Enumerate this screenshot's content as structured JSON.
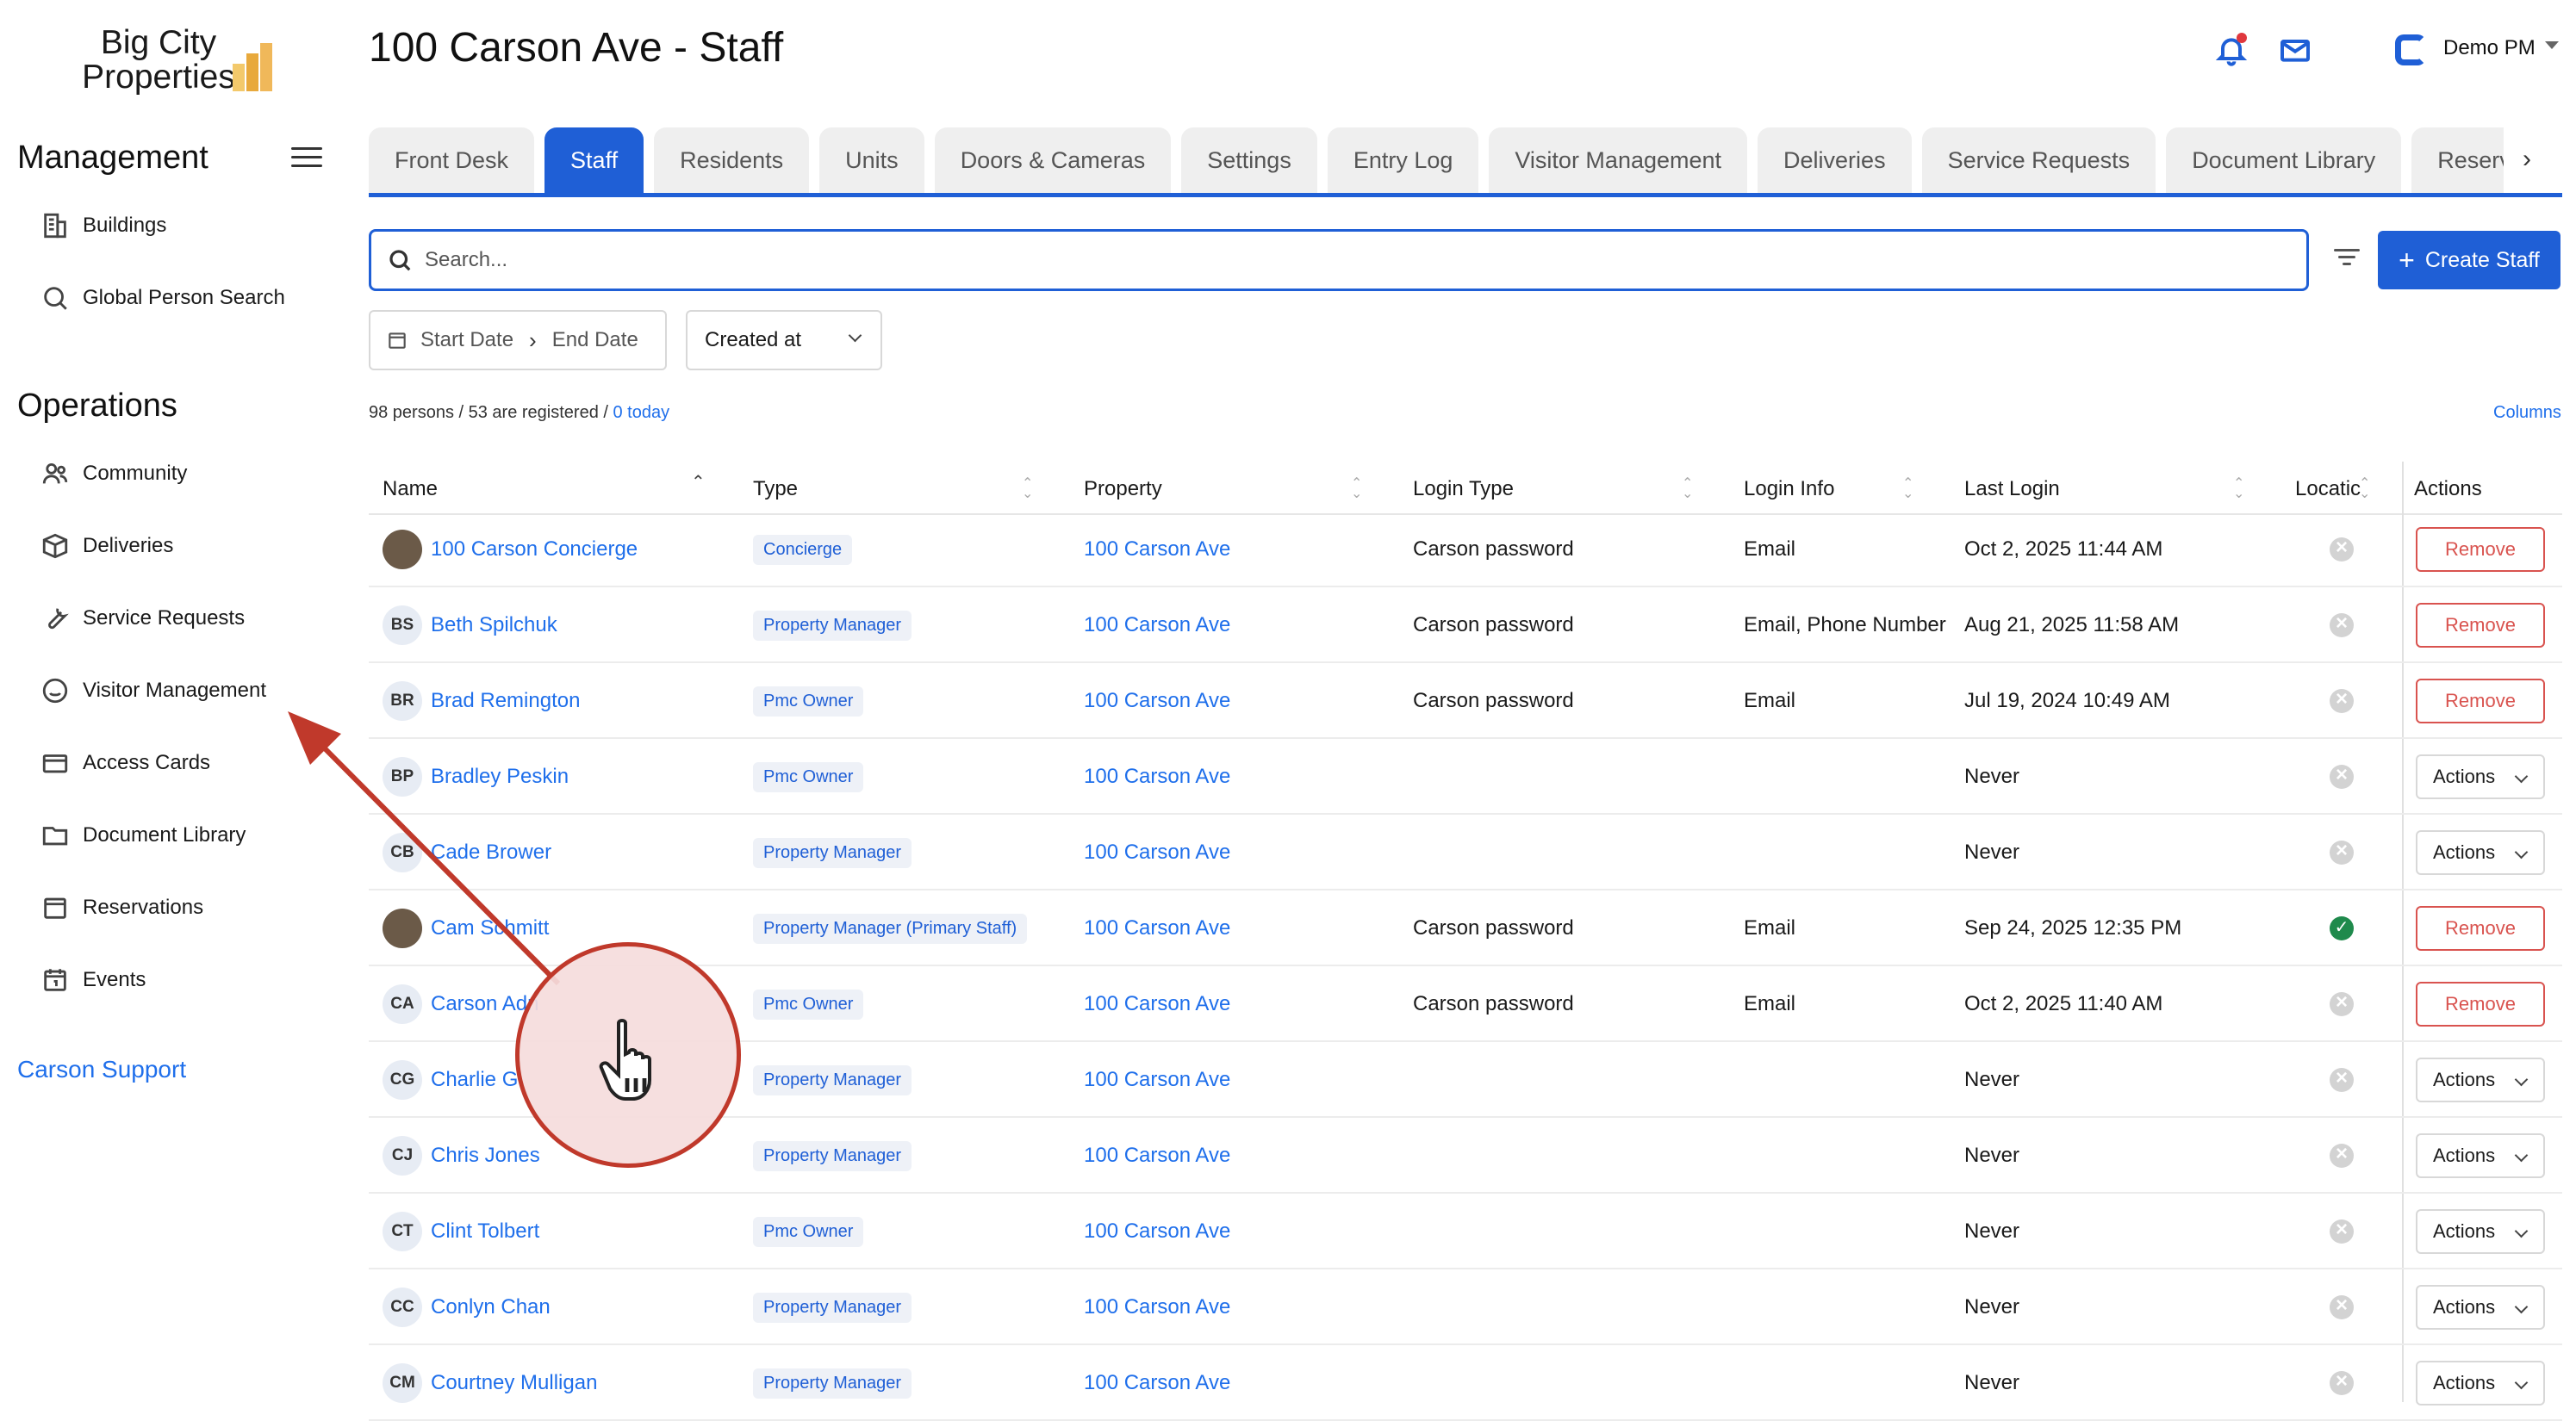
{
  "logo": {
    "line1": "Big City",
    "line2": "Properties"
  },
  "page_title": "100 Carson Ave - Staff",
  "user": {
    "name": "Demo PM"
  },
  "sidebar": {
    "management_title": "Management",
    "management_items": [
      {
        "label": "Buildings",
        "icon": "building-icon"
      },
      {
        "label": "Global Person Search",
        "icon": "search-icon"
      }
    ],
    "operations_title": "Operations",
    "operations_items": [
      {
        "label": "Community",
        "icon": "people-icon"
      },
      {
        "label": "Deliveries",
        "icon": "package-icon"
      },
      {
        "label": "Service Requests",
        "icon": "wrench-icon"
      },
      {
        "label": "Visitor Management",
        "icon": "smiley-icon"
      },
      {
        "label": "Access Cards",
        "icon": "card-icon"
      },
      {
        "label": "Document Library",
        "icon": "folder-icon"
      },
      {
        "label": "Reservations",
        "icon": "calendar-icon"
      },
      {
        "label": "Events",
        "icon": "calendar-event-icon"
      }
    ],
    "support_label": "Carson Support"
  },
  "tabs": [
    "Front Desk",
    "Staff",
    "Residents",
    "Units",
    "Doors & Cameras",
    "Settings",
    "Entry Log",
    "Visitor Management",
    "Deliveries",
    "Service Requests",
    "Document Library",
    "Reservab"
  ],
  "active_tab": "Staff",
  "search": {
    "placeholder": "Search..."
  },
  "create_button": "Create Staff",
  "date_filter": {
    "start": "Start Date",
    "end": "End Date"
  },
  "sort_select": "Created at",
  "stats": {
    "text": "98 persons / 53 are registered / ",
    "today": "0 today"
  },
  "columns_link": "Columns",
  "table": {
    "headers": [
      "Name",
      "Type",
      "Property",
      "Login Type",
      "Login Info",
      "Last Login",
      "Locatic",
      "Actions"
    ],
    "rows": [
      {
        "initials": "",
        "photo": true,
        "name": "100 Carson Concierge",
        "type": "Concierge",
        "property": "100 Carson Ave",
        "login_type": "Carson password",
        "login_info": "Email",
        "last_login": "Oct 2, 2025 11:44 AM",
        "location": "off",
        "action": "Remove"
      },
      {
        "initials": "BS",
        "photo": false,
        "name": "Beth Spilchuk",
        "type": "Property Manager",
        "property": "100 Carson Ave",
        "login_type": "Carson password",
        "login_info": "Email, Phone Number",
        "last_login": "Aug 21, 2025 11:58 AM",
        "location": "off",
        "action": "Remove"
      },
      {
        "initials": "BR",
        "photo": false,
        "name": "Brad Remington",
        "type": "Pmc Owner",
        "property": "100 Carson Ave",
        "login_type": "Carson password",
        "login_info": "Email",
        "last_login": "Jul 19, 2024 10:49 AM",
        "location": "off",
        "action": "Remove"
      },
      {
        "initials": "BP",
        "photo": false,
        "name": "Bradley Peskin",
        "type": "Pmc Owner",
        "property": "100 Carson Ave",
        "login_type": "",
        "login_info": "",
        "last_login": "Never",
        "location": "off",
        "action": "Actions"
      },
      {
        "initials": "CB",
        "photo": false,
        "name": "Cade Brower",
        "type": "Property Manager",
        "property": "100 Carson Ave",
        "login_type": "",
        "login_info": "",
        "last_login": "Never",
        "location": "off",
        "action": "Actions"
      },
      {
        "initials": "",
        "photo": true,
        "name": "Cam Schmitt",
        "type": "Property Manager (Primary Staff)",
        "property": "100 Carson Ave",
        "login_type": "Carson password",
        "login_info": "Email",
        "last_login": "Sep 24, 2025 12:35 PM",
        "location": "on",
        "action": "Remove"
      },
      {
        "initials": "CA",
        "photo": false,
        "name": "Carson Adn",
        "type": "Pmc Owner",
        "property": "100 Carson Ave",
        "login_type": "Carson password",
        "login_info": "Email",
        "last_login": "Oct 2, 2025 11:40 AM",
        "location": "off",
        "action": "Remove"
      },
      {
        "initials": "CG",
        "photo": false,
        "name": "Charlie G",
        "type": "Property Manager",
        "property": "100 Carson Ave",
        "login_type": "",
        "login_info": "",
        "last_login": "Never",
        "location": "off",
        "action": "Actions"
      },
      {
        "initials": "CJ",
        "photo": false,
        "name": "Chris Jones",
        "type": "Property Manager",
        "property": "100 Carson Ave",
        "login_type": "",
        "login_info": "",
        "last_login": "Never",
        "location": "off",
        "action": "Actions"
      },
      {
        "initials": "CT",
        "photo": false,
        "name": "Clint Tolbert",
        "type": "Pmc Owner",
        "property": "100 Carson Ave",
        "login_type": "",
        "login_info": "",
        "last_login": "Never",
        "location": "off",
        "action": "Actions"
      },
      {
        "initials": "CC",
        "photo": false,
        "name": "Conlyn Chan",
        "type": "Property Manager",
        "property": "100 Carson Ave",
        "login_type": "",
        "login_info": "",
        "last_login": "Never",
        "location": "off",
        "action": "Actions"
      },
      {
        "initials": "CM",
        "photo": false,
        "name": "Courtney Mulligan",
        "type": "Property Manager",
        "property": "100 Carson Ave",
        "login_type": "",
        "login_info": "",
        "last_login": "Never",
        "location": "off",
        "action": "Actions"
      }
    ]
  },
  "colors": {
    "accent": "#1f5fd6",
    "link": "#1f6feb",
    "danger": "#d9534f",
    "success": "#1f8a4c"
  }
}
